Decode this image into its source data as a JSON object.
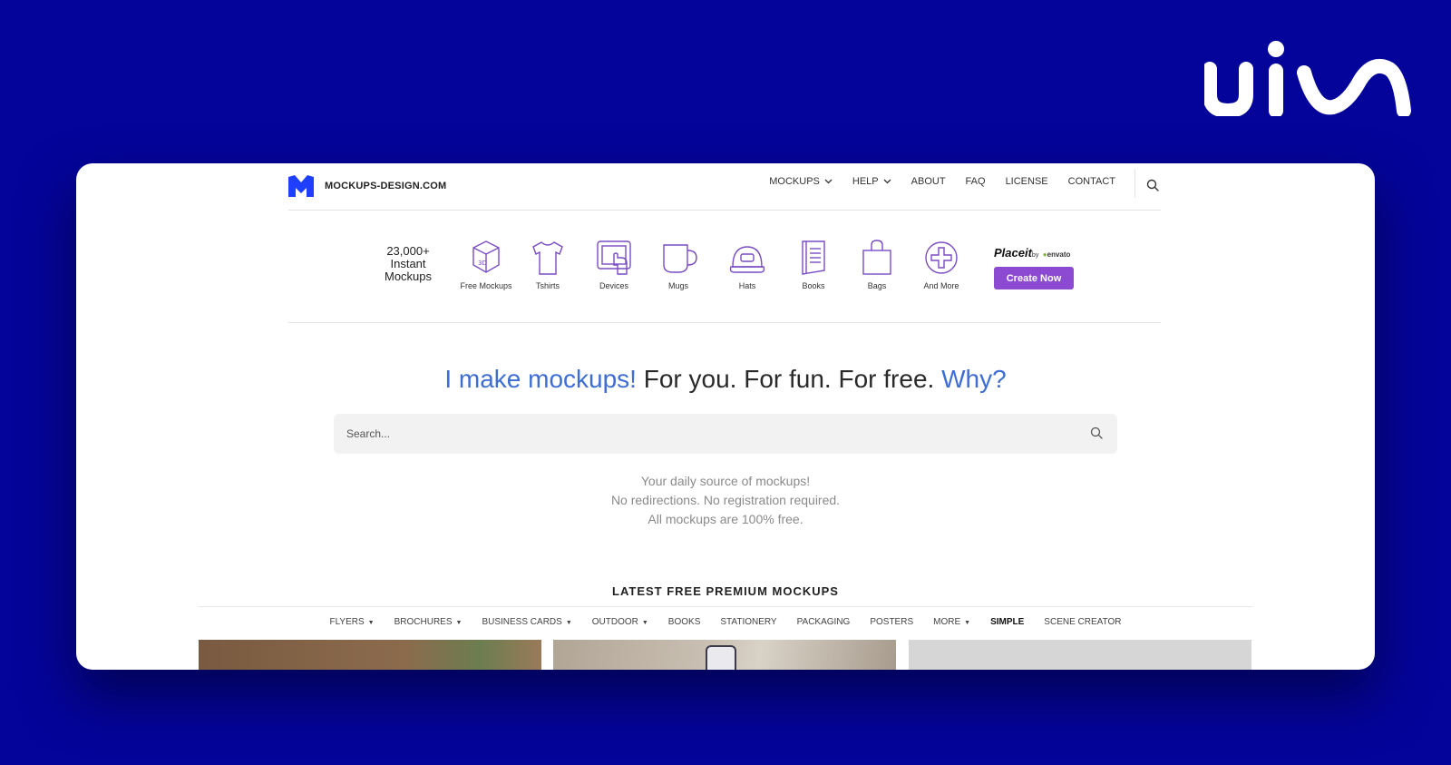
{
  "brand": {
    "icon": "uiw-logo"
  },
  "site": {
    "logo_icon": "m-logo-icon",
    "logo_text": "MOCKUPS-DESIGN.COM"
  },
  "nav": {
    "items": [
      {
        "label": "MOCKUPS",
        "dropdown": true
      },
      {
        "label": "HELP",
        "dropdown": true
      },
      {
        "label": "ABOUT",
        "dropdown": false
      },
      {
        "label": "FAQ",
        "dropdown": false
      },
      {
        "label": "LICENSE",
        "dropdown": false
      },
      {
        "label": "CONTACT",
        "dropdown": false
      }
    ],
    "search_icon": "search-icon"
  },
  "categories": {
    "count": "23,000+",
    "count_line2": "Instant",
    "count_line3": "Mockups",
    "items": [
      {
        "label": "Free Mockups",
        "icon": "box-3d-icon"
      },
      {
        "label": "Tshirts",
        "icon": "tshirt-icon"
      },
      {
        "label": "Devices",
        "icon": "devices-icon"
      },
      {
        "label": "Mugs",
        "icon": "mug-icon"
      },
      {
        "label": "Hats",
        "icon": "hat-icon"
      },
      {
        "label": "Books",
        "icon": "book-icon"
      },
      {
        "label": "Bags",
        "icon": "bag-icon"
      },
      {
        "label": "And More",
        "icon": "plus-circle-icon"
      }
    ],
    "placeit": {
      "brand": "Placeit",
      "by": "by",
      "envato": "envato",
      "button": "Create Now"
    }
  },
  "hero": {
    "part1": "I make mockups!",
    "part2": " For you. For fun. For free. ",
    "part3": "Why?"
  },
  "search": {
    "placeholder": "Search..."
  },
  "tagline": {
    "line1": "Your daily source of mockups!",
    "line2": "No redirections. No registration required.",
    "line3": "All mockups are 100% free."
  },
  "latest": {
    "title": "LATEST FREE PREMIUM MOCKUPS",
    "filters": [
      {
        "label": "FLYERS",
        "dropdown": true
      },
      {
        "label": "BROCHURES",
        "dropdown": true
      },
      {
        "label": "BUSINESS CARDS",
        "dropdown": true
      },
      {
        "label": "OUTDOOR",
        "dropdown": true
      },
      {
        "label": "BOOKS",
        "dropdown": false
      },
      {
        "label": "STATIONERY",
        "dropdown": false
      },
      {
        "label": "PACKAGING",
        "dropdown": false
      },
      {
        "label": "POSTERS",
        "dropdown": false
      },
      {
        "label": "MORE",
        "dropdown": true
      },
      {
        "label": "SIMPLE",
        "dropdown": false
      },
      {
        "label": "SCENE CREATOR",
        "dropdown": false
      }
    ]
  },
  "colors": {
    "background": "#04049a",
    "accent_blue": "#3f6ed3",
    "purple": "#8b4ad1",
    "logo_blue": "#1f3fff"
  }
}
